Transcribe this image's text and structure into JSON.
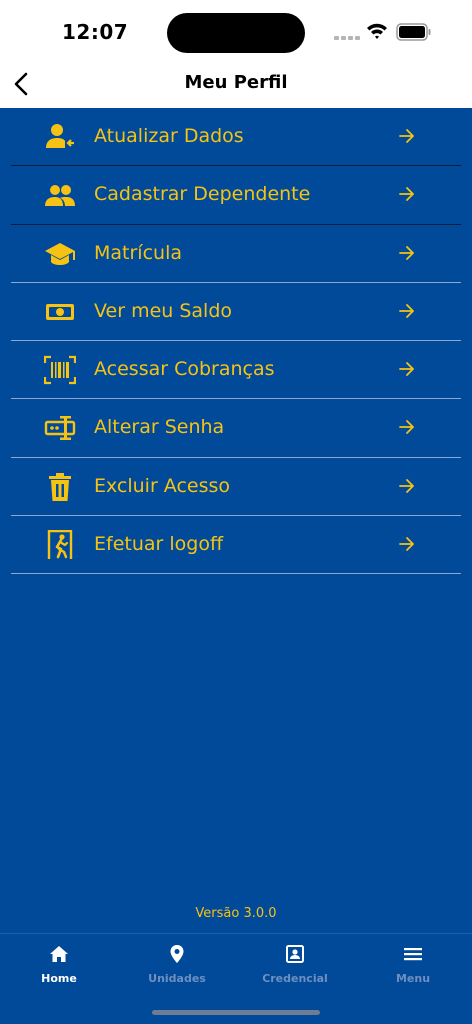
{
  "status_bar": {
    "time": "12:07"
  },
  "header": {
    "title": "Meu Perfil"
  },
  "menu": {
    "items": [
      {
        "label": "Atualizar Dados",
        "icon": "user-edit-icon"
      },
      {
        "label": "Cadastrar Dependente",
        "icon": "users-icon"
      },
      {
        "label": "Matrícula",
        "icon": "graduation-cap-icon"
      },
      {
        "label": "Ver meu Saldo",
        "icon": "money-icon"
      },
      {
        "label": "Acessar Cobranças",
        "icon": "barcode-scan-icon"
      },
      {
        "label": "Alterar Senha",
        "icon": "password-input-icon"
      },
      {
        "label": "Excluir Acesso",
        "icon": "trash-icon"
      },
      {
        "label": "Efetuar logoff",
        "icon": "exit-door-icon"
      }
    ]
  },
  "footer": {
    "version": "Versão 3.0.0"
  },
  "tabs": [
    {
      "label": "Home",
      "icon": "home-icon",
      "active": true
    },
    {
      "label": "Unidades",
      "icon": "location-pin-icon",
      "active": false
    },
    {
      "label": "Credencial",
      "icon": "id-badge-icon",
      "active": false
    },
    {
      "label": "Menu",
      "icon": "hamburger-menu-icon",
      "active": false
    }
  ],
  "colors": {
    "background": "#004A99",
    "accent": "#F6C314",
    "inactive_tab": "#6E8FC0"
  }
}
